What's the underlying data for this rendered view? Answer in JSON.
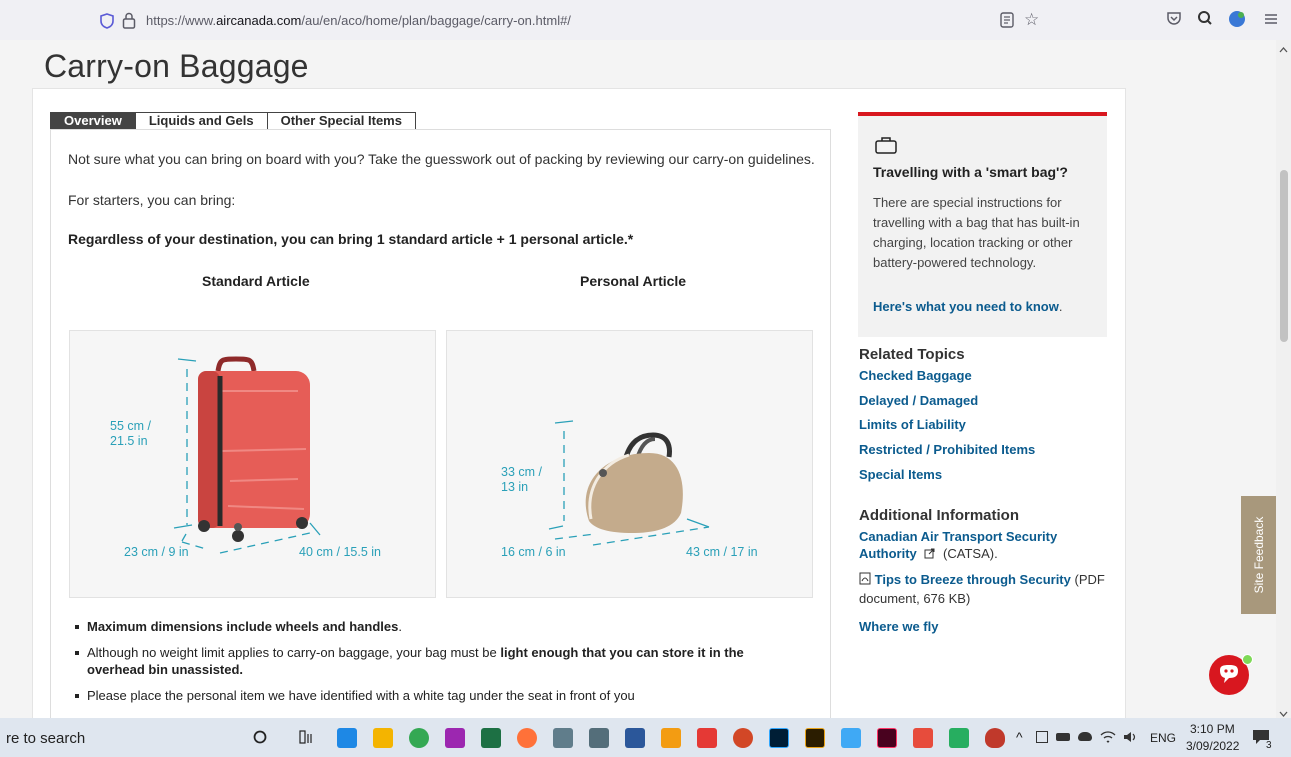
{
  "browser": {
    "url_prefix": "https://www.",
    "url_domain": "aircanada.com",
    "url_path": "/au/en/aco/home/plan/baggage/carry-on.html#/"
  },
  "page": {
    "title": "Carry-on Baggage",
    "tabs": [
      {
        "label": "Overview",
        "active": true
      },
      {
        "label": "Liquids and Gels",
        "active": false
      },
      {
        "label": "Other Special Items",
        "active": false
      }
    ],
    "intro": "Not sure what you can bring on board with you? Take the guesswork out of packing by reviewing our carry-on guidelines.",
    "starters": "For starters, you can bring:",
    "regardless": "Regardless of your destination, you can bring 1 standard article + 1 personal article.*",
    "standard_heading": "Standard Article",
    "personal_heading": "Personal Article",
    "standard_dims": {
      "height": "55 cm /\n21.5 in",
      "depth": "23 cm / 9 in",
      "width": "40 cm / 15.5 in"
    },
    "personal_dims": {
      "height": "33 cm /\n13 in",
      "depth": "16 cm / 6 in",
      "width": "43 cm / 17 in"
    },
    "bullets": {
      "b1_bold": "Maximum dimensions include wheels and handles",
      "b1_rest": ".",
      "b2_start": "Although no weight limit applies to carry-on baggage, your bag must be ",
      "b2_bold": "light enough that you can store it in the overhead bin unassisted.",
      "b3": "Please place the personal item we have identified with a white tag under the seat in front of you"
    }
  },
  "sidebar": {
    "smart_title": "Travelling with a 'smart bag'?",
    "smart_body": "There are special instructions for travelling with a bag that has built-in charging, location tracking or other battery-powered technology.",
    "smart_link": "Here's what you need to know",
    "smart_link_end": ".",
    "related_heading": "Related Topics",
    "related_links": [
      "Checked Baggage",
      "Delayed / Damaged",
      "Limits of Liability",
      "Restricted / Prohibited Items",
      "Special Items"
    ],
    "additional_heading": "Additional Information",
    "catsa_link_line1": "Canadian Air Transport Security",
    "catsa_link_line2": "Authority",
    "catsa_suffix": "(CATSA).",
    "tips_link": "Tips to Breeze through Security",
    "tips_suffix1": " (PDF",
    "tips_suffix2": "document, 676 KB)",
    "where_link": "Where we fly"
  },
  "feedback_label": "Site Feedback",
  "taskbar": {
    "search_text": "re to search",
    "lang": "ENG",
    "time": "3:10 PM",
    "date": "3/09/2022",
    "notif_count": "3"
  },
  "colors": {
    "accent_red": "#d8171f",
    "link_blue": "#0b5b8e",
    "dim_teal": "#2aa0b8"
  }
}
